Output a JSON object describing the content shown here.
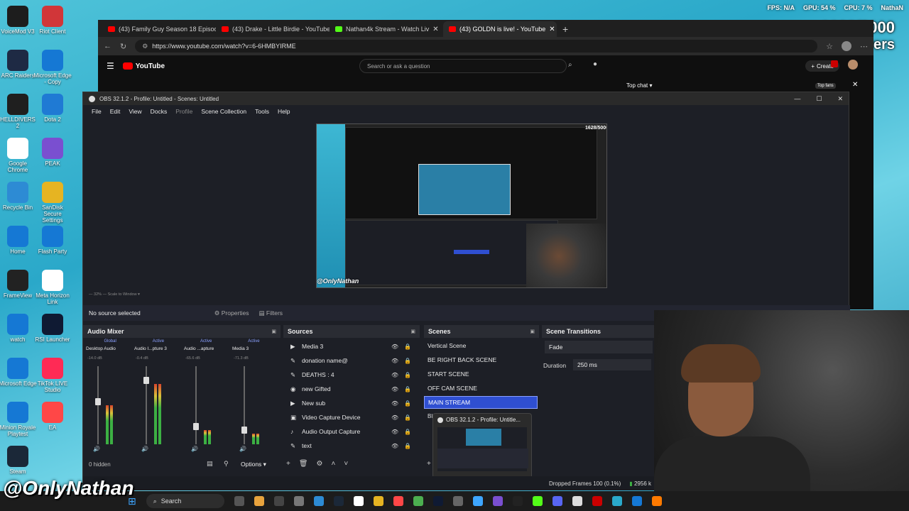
{
  "stats_overlay": {
    "fps": "FPS: N/A",
    "gpu": "GPU: 54 %",
    "cpu": "CPU: 7 %",
    "user": "NathaN"
  },
  "follower_goal": {
    "count": "1628/5000",
    "label": "Followers"
  },
  "desktop_icons": [
    {
      "label": "VoiceMod V3",
      "color": "#1d1d1d"
    },
    {
      "label": "Riot Client",
      "color": "#d13639"
    },
    {
      "label": "ARC Raiders",
      "color": "#1e2a44"
    },
    {
      "label": "Microsoft Edge - Copy",
      "color": "#1578d4"
    },
    {
      "label": "HELLDIVERS 2",
      "color": "#1f1f1f"
    },
    {
      "label": "Dota 2",
      "color": "#1f7ad4"
    },
    {
      "label": "Google Chrome",
      "color": "#ffffff"
    },
    {
      "label": "PEAK",
      "color": "#7a4fd0"
    },
    {
      "label": "Recycle Bin",
      "color": "#2d8bd4"
    },
    {
      "label": "SanDisk Secure Settings",
      "color": "#e6b422"
    },
    {
      "label": "Home",
      "color": "#1578d4"
    },
    {
      "label": "Flash Party",
      "color": "#1578d4"
    },
    {
      "label": "FrameView",
      "color": "#222222"
    },
    {
      "label": "Meta Horizon Link",
      "color": "#ffffff"
    },
    {
      "label": "watch",
      "color": "#1578d4"
    },
    {
      "label": "RSI Launcher",
      "color": "#0f1a33"
    },
    {
      "label": "Microsoft Edge",
      "color": "#1578d4"
    },
    {
      "label": "TikTok LIVE Studio",
      "color": "#ff2a55"
    },
    {
      "label": "Minion Royale Playtest",
      "color": "#1578d4"
    },
    {
      "label": "EA",
      "color": "#ff4747"
    },
    {
      "label": "Steam",
      "color": "#1b2838"
    }
  ],
  "browser": {
    "tabs": [
      {
        "label": "(43) Family Guy Season 18 Episod"
      },
      {
        "label": "(43) Drake - Little Birdie - YouTube"
      },
      {
        "label": "Nathan4k Stream - Watch Liv"
      },
      {
        "label": "(43) GOLDN is live! - YouTube"
      }
    ],
    "url": "https://www.youtube.com/watch?v=6-6HMBYIRME",
    "youtube_logo": "YouTube",
    "search_placeholder": "Search or ask a question",
    "create_label": "Create",
    "top_chat": "Top chat",
    "top_fans": "Top fans"
  },
  "obs": {
    "title": "OBS 32.1.2 - Profile: Untitled - Scenes: Untitled",
    "menu": [
      "File",
      "Edit",
      "View",
      "Docks",
      "Profile",
      "Scene Collection",
      "Tools",
      "Help"
    ],
    "preview_watermark": "@OnlyNathan",
    "scale_text": "Scale to Window",
    "no_source": "No source selected",
    "properties_label": "Properties",
    "filters_label": "Filters",
    "audio_mixer": {
      "title": "Audio Mixer",
      "tabs": [
        "Global",
        "Active",
        "Active",
        "Active"
      ],
      "channels": [
        {
          "name": "Desktop Audio",
          "db": "-14.0 dB",
          "level": 0.55
        },
        {
          "name": "Audio I...pture 3",
          "db": "-0.4 dB",
          "level": 0.85
        },
        {
          "name": "Audio ...apture",
          "db": "-65.6 dB",
          "level": 0.2
        },
        {
          "name": "Media 3",
          "db": "-71.3 dB",
          "level": 0.15
        }
      ],
      "hidden_count": "0 hidden"
    },
    "sources": {
      "title": "Sources",
      "items": [
        "Media 3",
        "donation name@",
        "DEATHS : 4",
        "new Gifted",
        "New sub",
        "Video Capture Device",
        "Audio Output Capture",
        "text"
      ]
    },
    "scenes": {
      "title": "Scenes",
      "items": [
        "Vertical Scene",
        "BE RIGHT BACK SCENE",
        "START SCENE",
        "OFF CAM SCENE",
        "MAIN STREAM"
      ],
      "selected": "MAIN STREAM",
      "partial_item": "Bl"
    },
    "scene_transitions": {
      "title": "Scene Transitions",
      "transition": "Fade",
      "duration_label": "Duration",
      "duration_value": "250 ms"
    },
    "options_label": "Options",
    "tooltip_title": "OBS 32.1.2 - Profile: Untitle...",
    "status": {
      "dropped": "Dropped Frames 100 (0.1%)",
      "bitrate": "2956 k"
    }
  },
  "watermark": "@OnlyNathan",
  "taskbar": {
    "search_label": "Search"
  }
}
